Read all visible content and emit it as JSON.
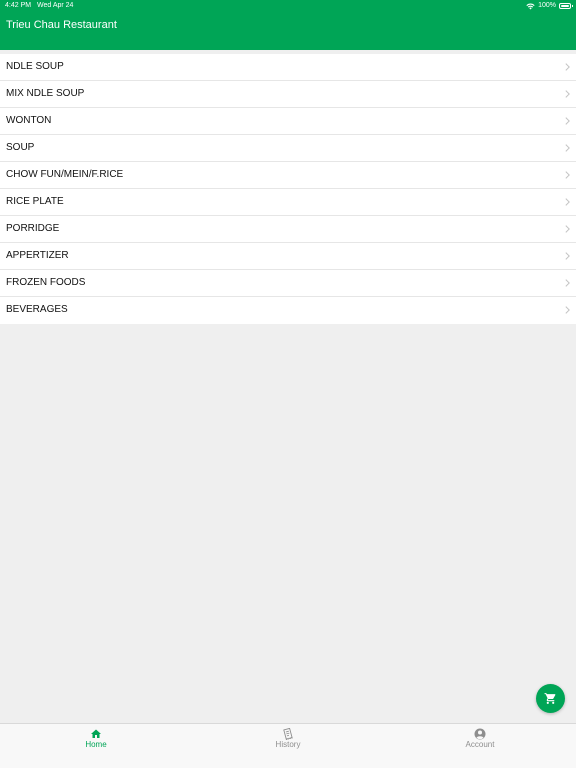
{
  "status_bar": {
    "time": "4:42 PM",
    "date": "Wed Apr 24",
    "battery": "100%",
    "icons": [
      "wifi-icon",
      "battery-icon"
    ]
  },
  "header": {
    "title": "Trieu Chau Restaurant"
  },
  "menu": {
    "items": [
      {
        "label": "NDLE SOUP"
      },
      {
        "label": "MIX NDLE SOUP"
      },
      {
        "label": "WONTON"
      },
      {
        "label": "SOUP"
      },
      {
        "label": "CHOW FUN/MEIN/F.RICE"
      },
      {
        "label": "RICE PLATE"
      },
      {
        "label": "PORRIDGE"
      },
      {
        "label": "APPERTIZER"
      },
      {
        "label": "FROZEN FOODS"
      },
      {
        "label": "BEVERAGES"
      }
    ],
    "item_icon": "chevron-right-icon"
  },
  "fab": {
    "icon": "cart-icon"
  },
  "tab_bar": {
    "active": "Home",
    "tabs": [
      {
        "label": "Home",
        "icon": "home-icon"
      },
      {
        "label": "History",
        "icon": "receipt-icon"
      },
      {
        "label": "Account",
        "icon": "account-icon"
      }
    ]
  },
  "colors": {
    "accent": "#00a556",
    "background": "#efefef",
    "inactive_tab": "#8e8e8e"
  }
}
